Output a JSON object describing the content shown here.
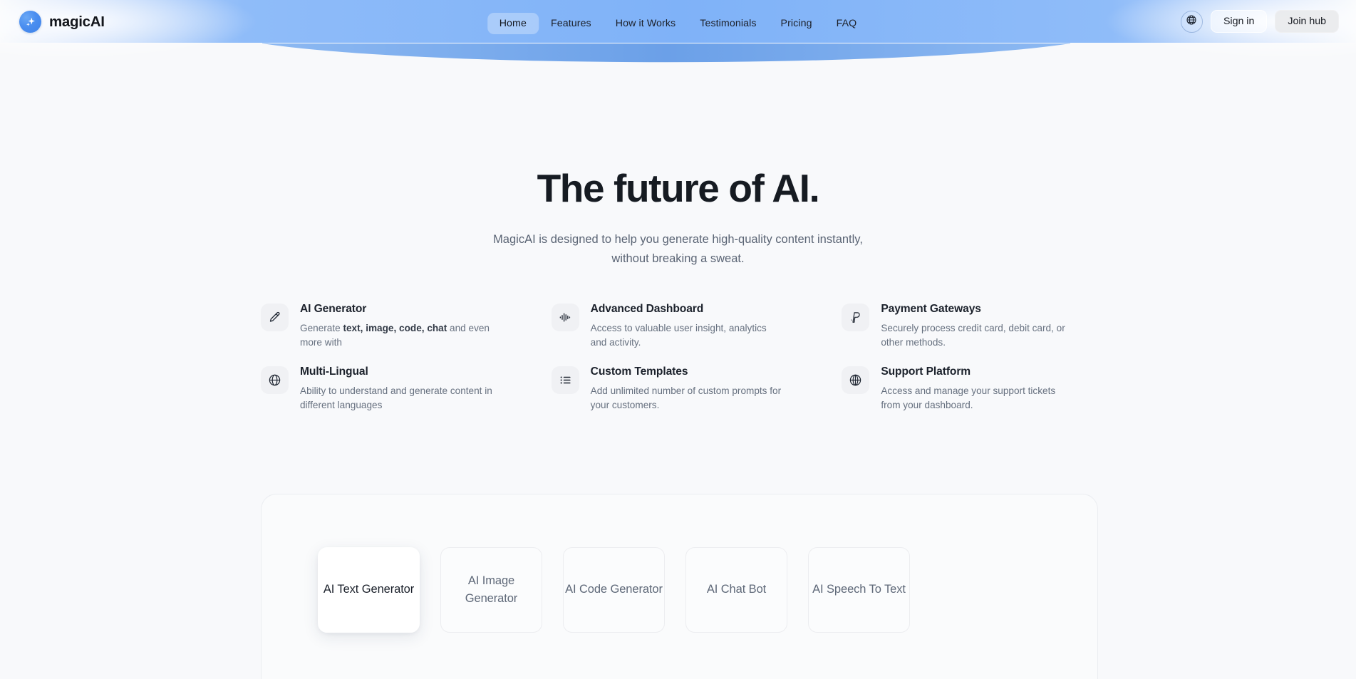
{
  "brand": {
    "name": "magicAI",
    "logo_icon": "sparkle-icon",
    "logo_color": "#4a8ef0"
  },
  "header": {
    "nav": [
      {
        "label": "Home",
        "active": true
      },
      {
        "label": "Features",
        "active": false
      },
      {
        "label": "How it Works",
        "active": false
      },
      {
        "label": "Testimonials",
        "active": false
      },
      {
        "label": "Pricing",
        "active": false
      },
      {
        "label": "FAQ",
        "active": false
      }
    ],
    "language_icon": "globe-icon",
    "sign_in_label": "Sign in",
    "join_hub_label": "Join hub",
    "banner_color": "#7db2f7"
  },
  "hero": {
    "title": "The future of AI.",
    "subtitle": "MagicAI is designed to help you generate high-quality content instantly, without breaking a sweat."
  },
  "features": [
    {
      "icon": "pencil-icon",
      "title": "AI Generator",
      "desc_pre": "Generate ",
      "desc_bold": "text, image, code, chat",
      "desc_post": " and even more with"
    },
    {
      "icon": "waveform-icon",
      "title": "Advanced Dashboard",
      "desc_pre": "Access to valuable user insight, analytics and activity.",
      "desc_bold": "",
      "desc_post": ""
    },
    {
      "icon": "paypal-icon",
      "title": "Payment Gateways",
      "desc_pre": "Securely process credit card, debit card, or other methods.",
      "desc_bold": "",
      "desc_post": ""
    },
    {
      "icon": "globe-icon",
      "title": "Multi-Lingual",
      "desc_pre": "Ability to understand and generate content in different languages",
      "desc_bold": "",
      "desc_post": ""
    },
    {
      "icon": "list-icon",
      "title": "Custom Templates",
      "desc_pre": "Add unlimited number of custom prompts for your customers.",
      "desc_bold": "",
      "desc_post": ""
    },
    {
      "icon": "lifebuoy-icon",
      "title": "Support Platform",
      "desc_pre": "Access and manage your support tickets from your dashboard.",
      "desc_bold": "",
      "desc_post": ""
    }
  ],
  "tabs": [
    {
      "label": "AI Text Generator",
      "active": true
    },
    {
      "label": "AI Image Generator",
      "active": false
    },
    {
      "label": "AI Code Generator",
      "active": false
    },
    {
      "label": "AI Chat Bot",
      "active": false
    },
    {
      "label": "AI Speech To Text",
      "active": false
    }
  ]
}
